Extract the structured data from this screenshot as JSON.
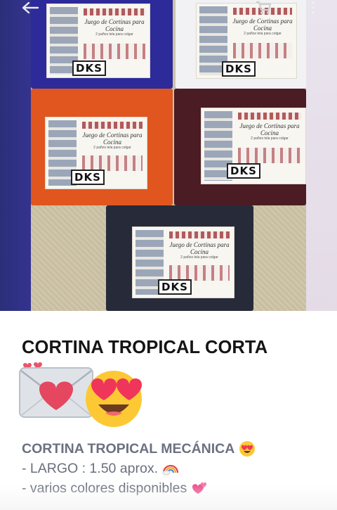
{
  "product": {
    "title": "CORTINA TROPICAL CORTA",
    "description_title": "CORTINA TROPICAL MECÁNICA",
    "lines": [
      "- LARGO : 1.50 aprox.",
      "- varios colores disponibles"
    ]
  },
  "photo": {
    "label_title": "Juego de Cortinas para Cocina",
    "label_sub": "2 paños tela para colgar",
    "brand": "DKS",
    "fabric_colors": [
      "#2d2a9a",
      "#f2f1f4",
      "#e0561e",
      "#4b1c24",
      "#262a39"
    ]
  },
  "toolbar": {
    "back_icon": "arrow-left",
    "cart_icon": "shopping-cart",
    "more_icon": "more-vertical"
  },
  "emojis": {
    "big": [
      "love-letter",
      "heart-eyes"
    ],
    "title_line": "heart-eyes",
    "largo_line": "rainbow",
    "colores_line": "revolving-hearts"
  }
}
